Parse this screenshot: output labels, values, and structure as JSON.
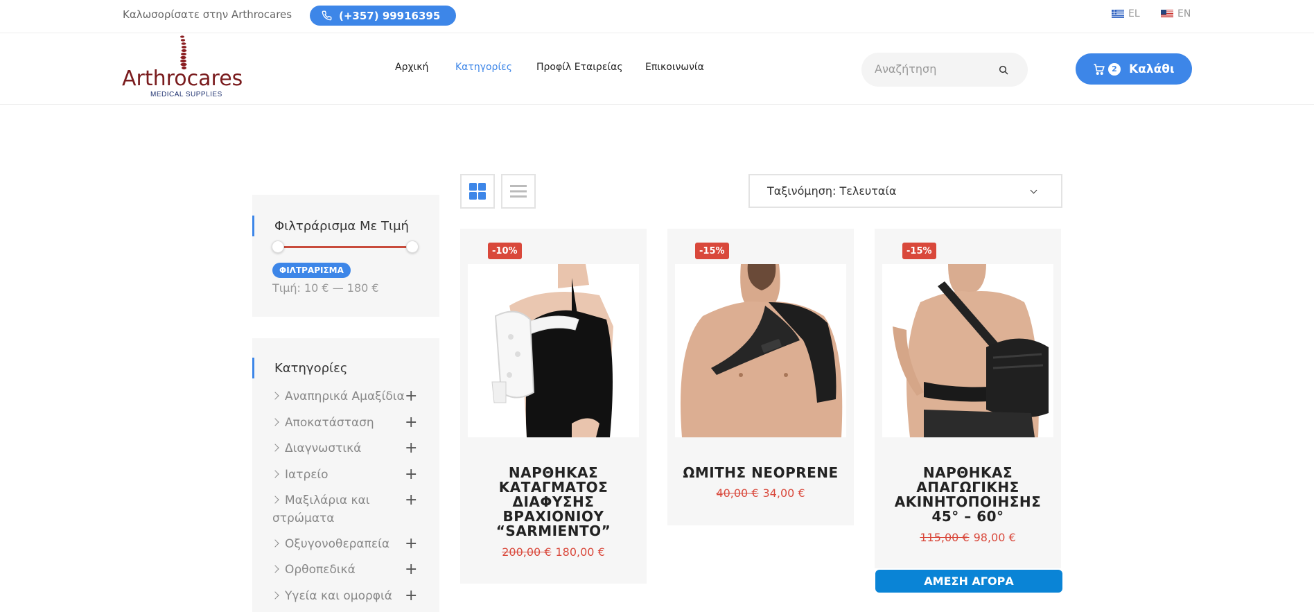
{
  "topbar": {
    "welcome": "Καλωσορίσατε στην Arthrocares",
    "phone": "(+357) 99916395",
    "lang_el": "EL",
    "lang_en": "EN"
  },
  "header": {
    "logo_text": "Arthrocares",
    "logo_sub": "MEDICAL SUPPLIES",
    "nav": [
      "Αρχική",
      "Κατηγορίες",
      "Προφίλ Εταιρείας",
      "Επικοινωνία"
    ],
    "search_placeholder": "Αναζήτηση",
    "cart_count": "2",
    "cart_label": "Καλάθι"
  },
  "sidebar": {
    "price_title": "Φιλτράρισμα Με Τιμή",
    "filter_button": "ΦΙΛΤΡΑΡΙΣΜΑ",
    "price_range": "Τιμή: 10 € — 180 €",
    "categories_title": "Κατηγορίες",
    "categories": [
      "Αναπηρικά Αμαξίδια",
      "Αποκατάσταση",
      "Διαγνωστικά",
      "Ιατρείο",
      "Μαξιλάρια και στρώματα",
      "Οξυγονοθεραπεία",
      "Ορθοπεδικά",
      "Υγεία και ομορφιά"
    ]
  },
  "toolbar": {
    "sort_label": "Ταξινόμηση: Τελευταία"
  },
  "products": [
    {
      "badge": "-10%",
      "title": "ΝΑΡΘΗΚΑΣ ΚΑΤΑΓΜΑΤΟΣ ΔΙΑΦΥΣΗΣ ΒΡΑΧΙΟΝΙΟΥ “SARMIENTO”",
      "old_price": "200,00 €",
      "price": "180,00 €"
    },
    {
      "badge": "-15%",
      "title": "ΩΜΙΤΗΣ NEOPRENE",
      "old_price": "40,00 €",
      "price": "34,00 €"
    },
    {
      "badge": "-15%",
      "title": "ΝΑΡΘΗΚΑΣ ΑΠΑΓΩΓΙΚΗΣ ΑΚΙΝΗΤΟΠΟΙΗΣΗΣ 45° – 60°",
      "old_price": "115,00 €",
      "price": "98,00 €",
      "buy_label": "ΑΜΕΣΗ ΑΓΟΡΑ"
    }
  ],
  "colors": {
    "accent": "#3d86e8",
    "sale": "#d9483b",
    "brand": "#7a1c1e",
    "buy": "#0a84d6"
  }
}
